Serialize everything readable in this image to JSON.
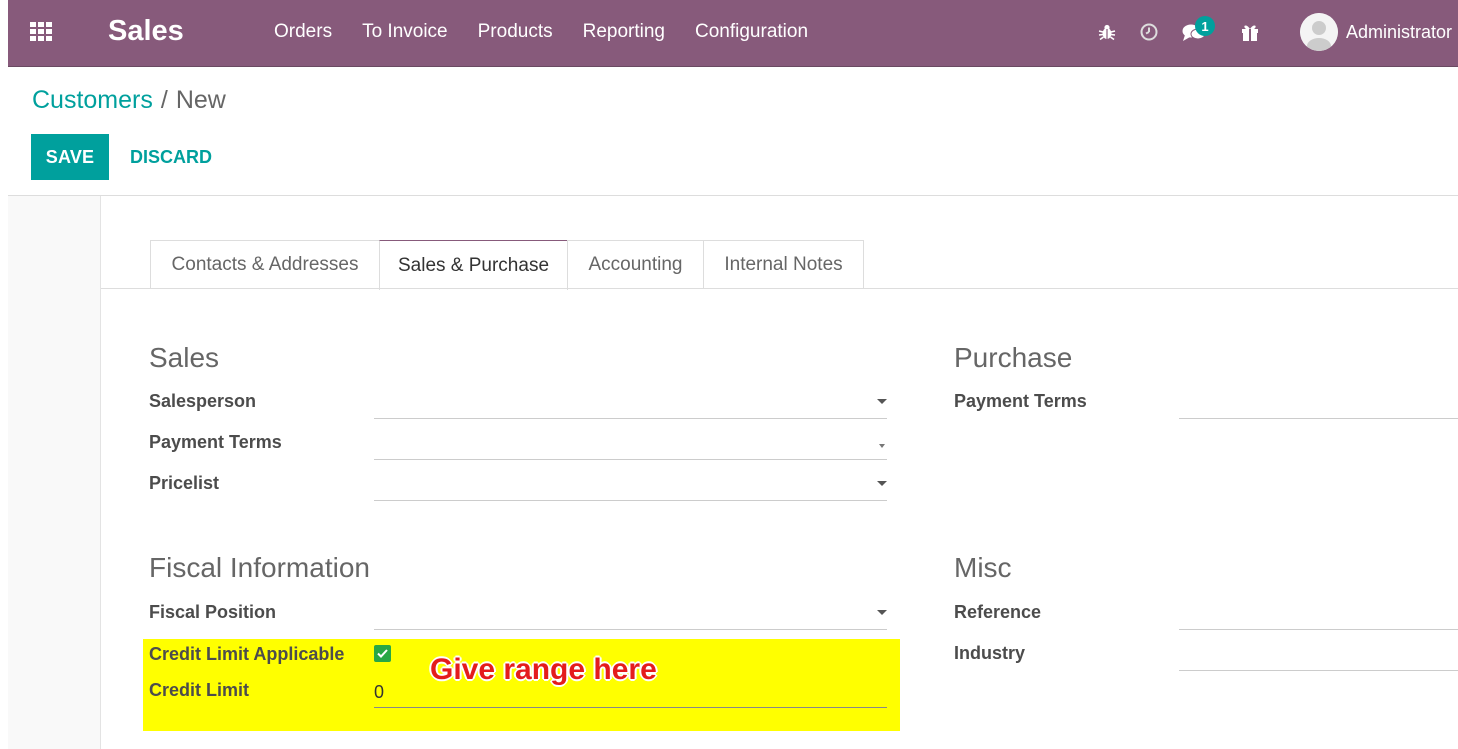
{
  "navbar": {
    "app_title": "Sales",
    "menu": [
      "Orders",
      "To Invoice",
      "Products",
      "Reporting",
      "Configuration"
    ],
    "messages_count": "1",
    "user_name": "Administrator",
    "color": "#875a7b"
  },
  "breadcrumb": {
    "parent": "Customers",
    "separator": "/",
    "current": "New"
  },
  "buttons": {
    "save": "SAVE",
    "discard": "DISCARD"
  },
  "tabs": [
    {
      "label": "Contacts & Addresses",
      "active": false
    },
    {
      "label": "Sales & Purchase",
      "active": true
    },
    {
      "label": "Accounting",
      "active": false
    },
    {
      "label": "Internal Notes",
      "active": false
    }
  ],
  "sales": {
    "title": "Sales",
    "salesperson_label": "Salesperson",
    "payment_terms_label": "Payment Terms",
    "pricelist_label": "Pricelist"
  },
  "purchase": {
    "title": "Purchase",
    "payment_terms_label": "Payment Terms"
  },
  "fiscal": {
    "title": "Fiscal Information",
    "fiscal_position_label": "Fiscal Position",
    "credit_limit_applicable_label": "Credit Limit Applicable",
    "credit_limit_applicable_checked": true,
    "credit_limit_label": "Credit Limit",
    "credit_limit_value": "0"
  },
  "misc": {
    "title": "Misc",
    "reference_label": "Reference",
    "industry_label": "Industry"
  },
  "annotation": {
    "text": "Give range here",
    "highlight_color": "#ffff00",
    "text_color": "#e41c1c"
  },
  "accent_color": "#00a09d"
}
